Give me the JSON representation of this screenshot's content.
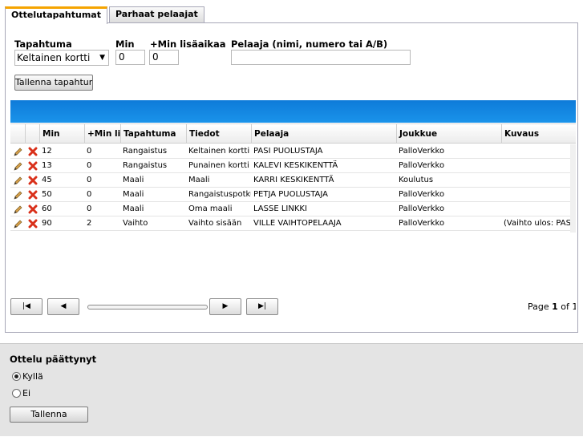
{
  "tabs": [
    {
      "label": "Ottelutapahtumat",
      "active": true
    },
    {
      "label": "Parhaat pelaajat",
      "active": false
    }
  ],
  "form": {
    "event_label": "Tapahtuma",
    "event_value": "Keltainen kortti",
    "min_label": "Min",
    "min_value": "0",
    "extra_label": "+Min lisäaikaa",
    "extra_value": "0",
    "player_label": "Pelaaja (nimi, numero tai A/B)",
    "player_value": "",
    "save_event_button": "Tallenna tapahtuma"
  },
  "grid": {
    "columns": [
      "Min",
      "+Min li",
      "Tapahtuma",
      "Tiedot",
      "Pelaaja",
      "Joukkue",
      "Kuvaus"
    ],
    "rows": [
      {
        "min": "12",
        "extra": "0",
        "event": "Rangaistus",
        "details": "Keltainen kortti",
        "player": "PASI PUOLUSTAJA",
        "team": "PalloVerkko",
        "desc": ""
      },
      {
        "min": "13",
        "extra": "0",
        "event": "Rangaistus",
        "details": "Punainen kortti",
        "player": "KALEVI KESKIKENTTÄ",
        "team": "PalloVerkko",
        "desc": ""
      },
      {
        "min": "45",
        "extra": "0",
        "event": "Maali",
        "details": "Maali",
        "player": "KARRI KESKIKENTTÄ",
        "team": "Koulutus",
        "desc": ""
      },
      {
        "min": "50",
        "extra": "0",
        "event": "Maali",
        "details": "Rangaistuspotku",
        "player": "PETJA PUOLUSTAJA",
        "team": "PalloVerkko",
        "desc": ""
      },
      {
        "min": "60",
        "extra": "0",
        "event": "Maali",
        "details": "Oma maali",
        "player": "LASSE LINKKI",
        "team": "PalloVerkko",
        "desc": ""
      },
      {
        "min": "90",
        "extra": "2",
        "event": "Vaihto",
        "details": "Vaihto sisään",
        "player": "VILLE VAIHTOPELAAJA",
        "team": "PalloVerkko",
        "desc": "(Vaihto ulos: PAS"
      }
    ],
    "pager": {
      "prefix": "Page",
      "current": "1",
      "of": "of 1"
    }
  },
  "match_end": {
    "title": "Ottelu päättynyt",
    "options": [
      {
        "label": "Kyllä",
        "selected": true
      },
      {
        "label": "Ei",
        "selected": false
      }
    ],
    "save_button": "Tallenna"
  },
  "icons": {
    "edit": "pencil-icon",
    "delete": "delete-x-icon",
    "first": "first-page-icon",
    "prev": "previous-page-icon",
    "next": "next-page-icon",
    "last": "last-page-icon",
    "dropdown": "chevron-down-icon"
  },
  "colors": {
    "accent_tab": "#f5a400",
    "grid_header_bar": "#1a8ae6",
    "delete_icon": "#d9301a",
    "edit_icon": "#d7a04a"
  }
}
